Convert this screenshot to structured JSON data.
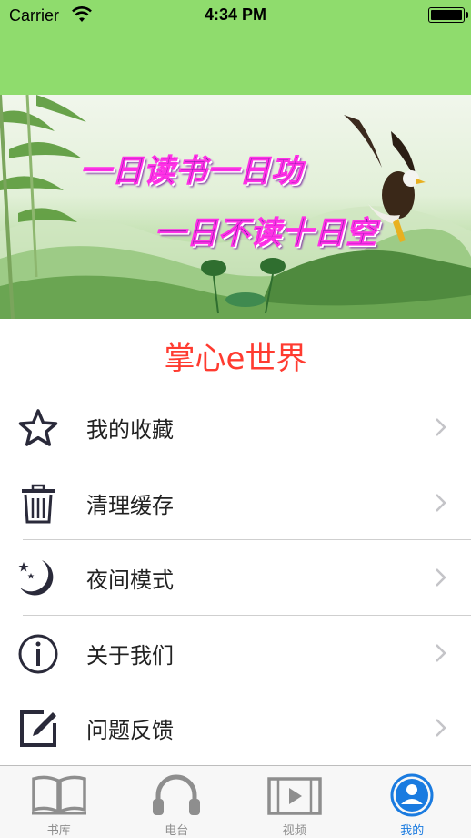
{
  "status_bar": {
    "carrier": "Carrier",
    "time": "4:34 PM"
  },
  "banner": {
    "line1": "一日读书一日功",
    "line2": "一日不读十日空"
  },
  "app_title": "掌心e世界",
  "menu": {
    "items": [
      {
        "label": "我的收藏",
        "icon": "star-icon"
      },
      {
        "label": "清理缓存",
        "icon": "trash-icon"
      },
      {
        "label": "夜间模式",
        "icon": "moon-icon"
      },
      {
        "label": "关于我们",
        "icon": "info-icon"
      },
      {
        "label": "问题反馈",
        "icon": "edit-icon"
      }
    ]
  },
  "tabbar": {
    "tabs": [
      {
        "label": "书库",
        "icon": "book-icon"
      },
      {
        "label": "电台",
        "icon": "headphones-icon"
      },
      {
        "label": "视频",
        "icon": "video-icon"
      },
      {
        "label": "我的",
        "icon": "user-icon",
        "active": true
      }
    ]
  },
  "colors": {
    "header": "#8fdc6d",
    "title": "#ff3b30",
    "active_tab": "#1a7be0"
  }
}
